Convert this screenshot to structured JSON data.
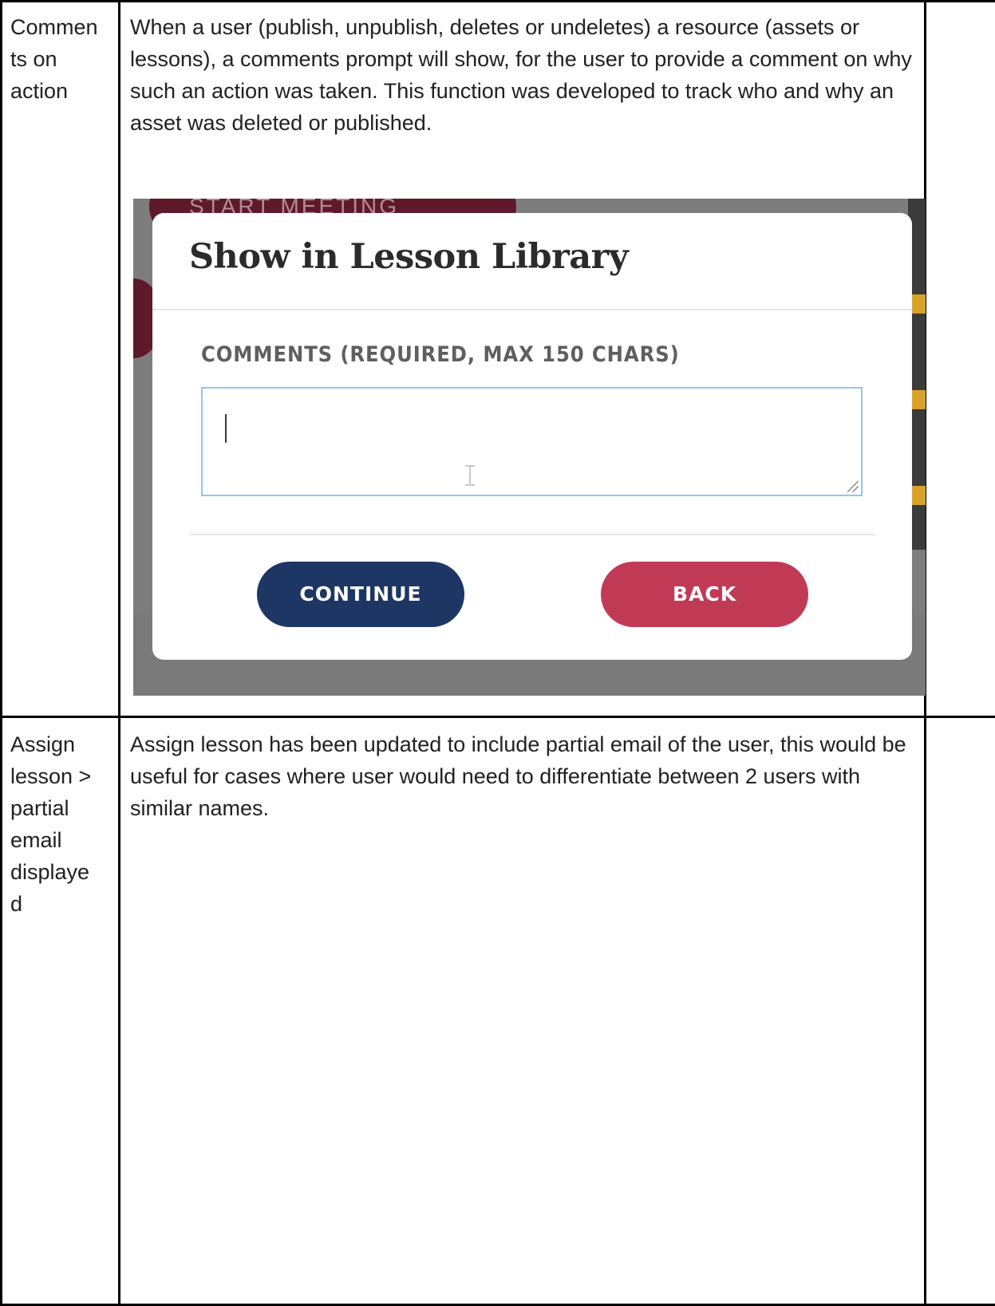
{
  "rows": [
    {
      "label": "Commen\nts on\naction",
      "description": "When a user (publish, unpublish, deletes or undeletes) a resource (assets or lessons), a comments prompt will show, for the user to provide a comment on why such an action was taken. This function was developed to track who and why an asset was deleted or published."
    },
    {
      "label": "Assign\nlesson >\npartial\nemail\ndisplaye\nd",
      "description": "Assign lesson has been updated to include partial email of the user, this would be useful for cases where user would need to  differentiate between 2 users with similar names."
    }
  ],
  "screenshot": {
    "background_text": "START MEETING",
    "dialog": {
      "title": "Show in Lesson Library",
      "field_label": "COMMENTS (REQUIRED, MAX 150 CHARS)",
      "field_value": "",
      "continue_label": "CONTINUE",
      "back_label": "BACK"
    },
    "colors": {
      "continue_button": "#1d3663",
      "back_button": "#c13a55",
      "input_focus_border": "#90c6ee",
      "overlay": "#7d7d7d"
    }
  }
}
